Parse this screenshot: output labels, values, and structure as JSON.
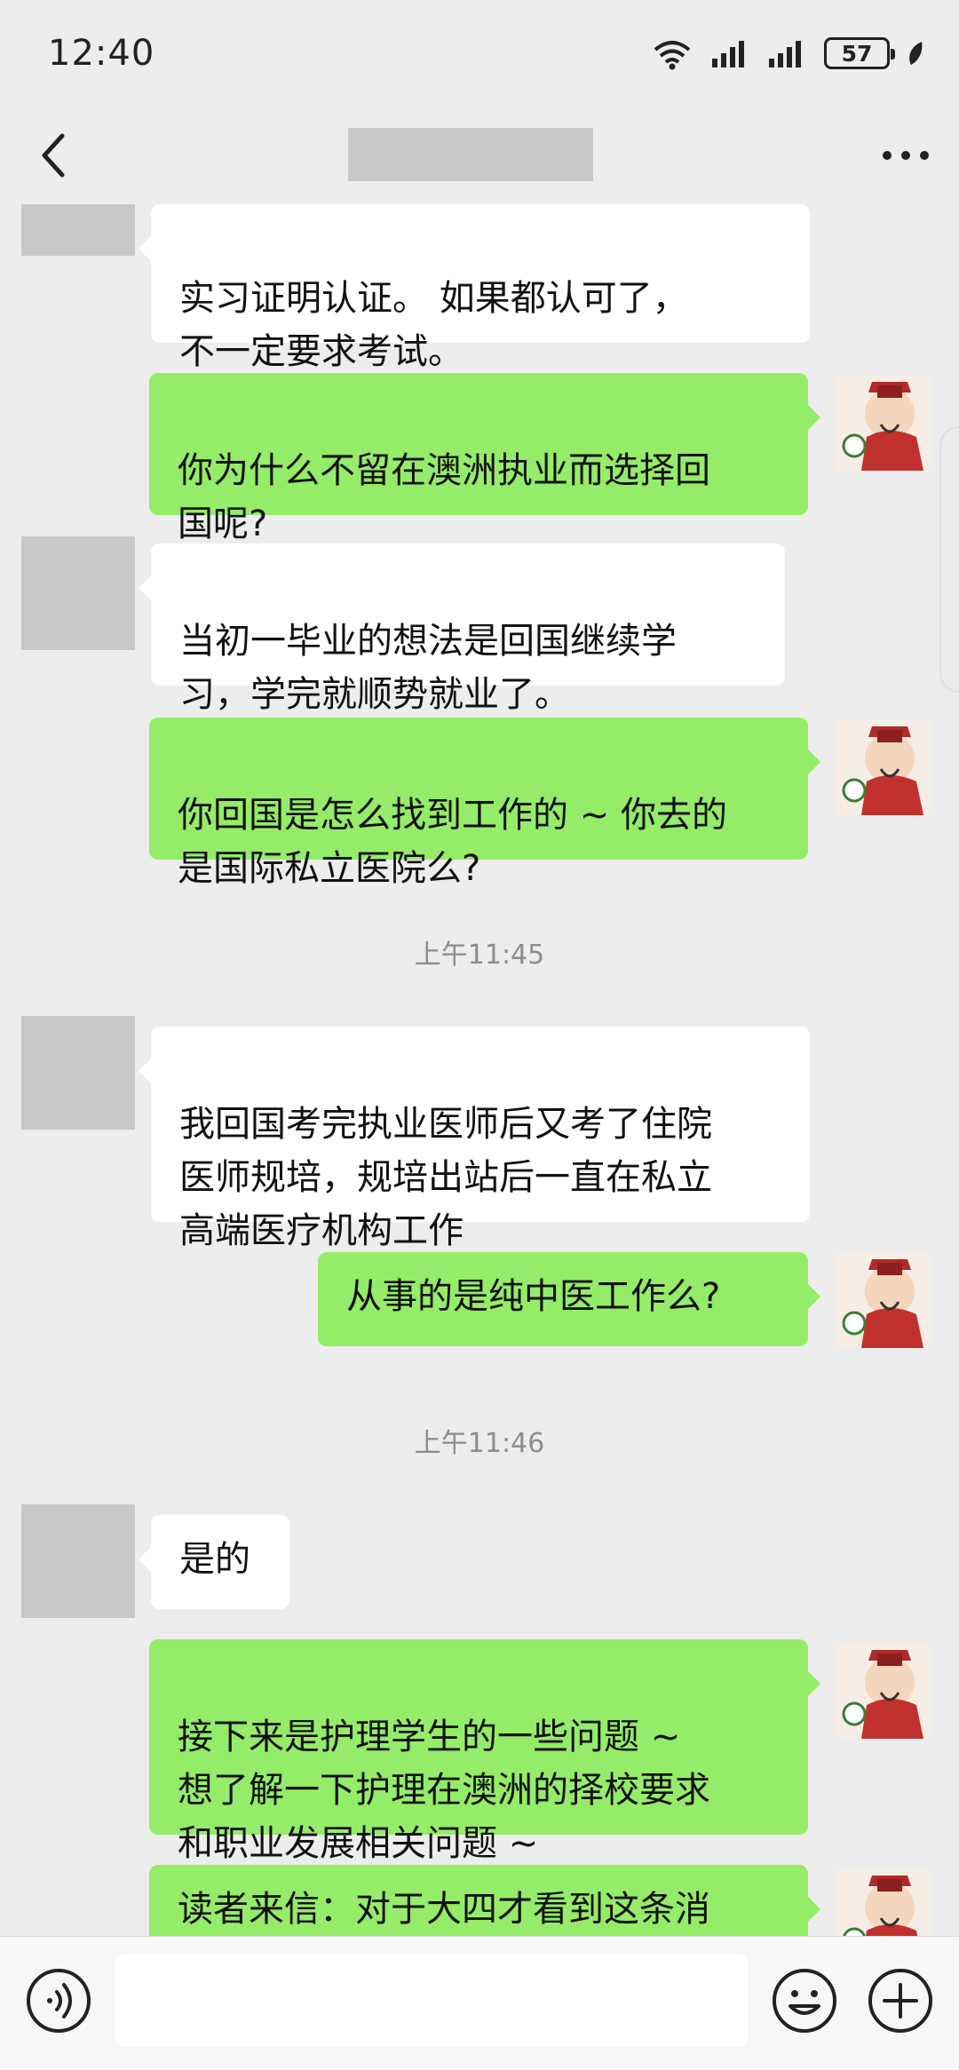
{
  "status_bar": {
    "time": "12:40",
    "battery": "57",
    "signal_tag": "6"
  },
  "nav": {
    "back_icon": "chevron-left-icon",
    "more_icon": "more-dots-icon"
  },
  "messages": [
    {
      "side": "left",
      "text": "实习证明认证。 如果都认可了，\n不一定要求考试。"
    },
    {
      "side": "right",
      "text": "你为什么不留在澳洲执业而选择回\n国呢?"
    },
    {
      "side": "left",
      "text": "当初一毕业的想法是回国继续学\n习，学完就顺势就业了。"
    },
    {
      "side": "right",
      "text": "你回国是怎么找到工作的 ~ 你去的\n是国际私立医院么?"
    },
    {
      "side": "time",
      "text": "上午11:45"
    },
    {
      "side": "left",
      "text": "我回国考完执业医师后又考了住院\n医师规培，规培出站后一直在私立\n高端医疗机构工作"
    },
    {
      "side": "right",
      "text": "从事的是纯中医工作么?"
    },
    {
      "side": "time",
      "text": "上午11:46"
    },
    {
      "side": "left",
      "text": "是的"
    },
    {
      "side": "right",
      "text": "接下来是护理学生的一些问题 ~\n想了解一下护理在澳洲的择校要求\n和职业发展相关问题 ~"
    },
    {
      "side": "right",
      "text": "读者来信：对于大四才看到这条消"
    }
  ],
  "input": {
    "value": "",
    "placeholder": ""
  },
  "toolbar": {
    "voice_icon": "voice-icon",
    "emoji_icon": "emoji-icon",
    "plus_icon": "plus-icon"
  },
  "colors": {
    "background": "#ededed",
    "my_bubble": "#95ec69",
    "their_bubble": "#ffffff",
    "timestamp": "#8c8c8c"
  }
}
